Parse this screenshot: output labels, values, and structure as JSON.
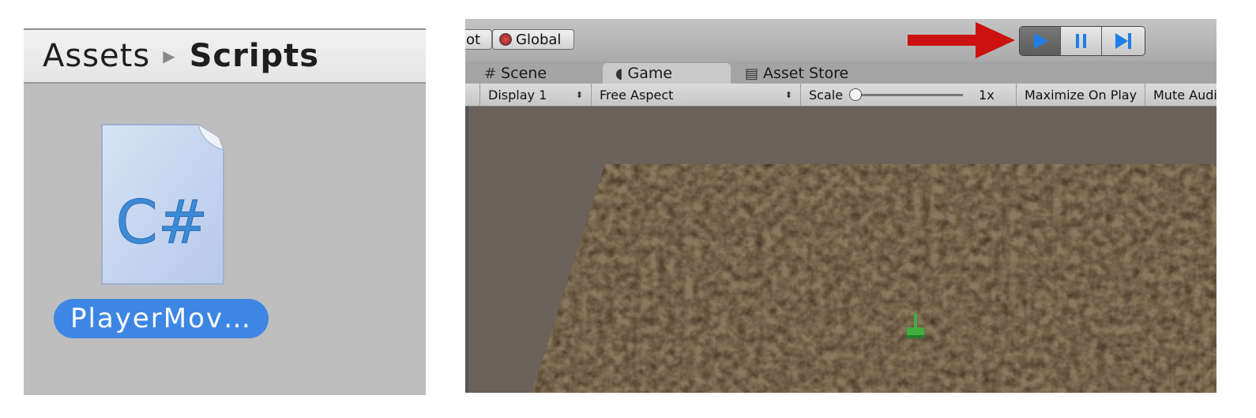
{
  "project": {
    "breadcrumb": [
      "Assets",
      "Scripts"
    ],
    "file_icon_text": "C#",
    "file_name": "PlayerMov…"
  },
  "toolbar": {
    "pivot_label": "ot",
    "global_label": "Global",
    "play_controls": [
      "play",
      "pause",
      "step"
    ]
  },
  "tabs": [
    {
      "label": "Scene",
      "icon": "hash-icon"
    },
    {
      "label": "Game",
      "icon": "pacman-icon",
      "active": true
    },
    {
      "label": "Asset Store",
      "icon": "bag-icon"
    }
  ],
  "game_toolbar": {
    "display": "Display 1",
    "aspect": "Free Aspect",
    "scale_label": "Scale",
    "scale_value": "1x",
    "maximize": "Maximize On Play",
    "mute": "Mute Audi"
  },
  "colors": {
    "accent": "#3d86e3",
    "arrow": "#cc1111",
    "terrain": "#4a3822",
    "player": "#3fae3f"
  }
}
